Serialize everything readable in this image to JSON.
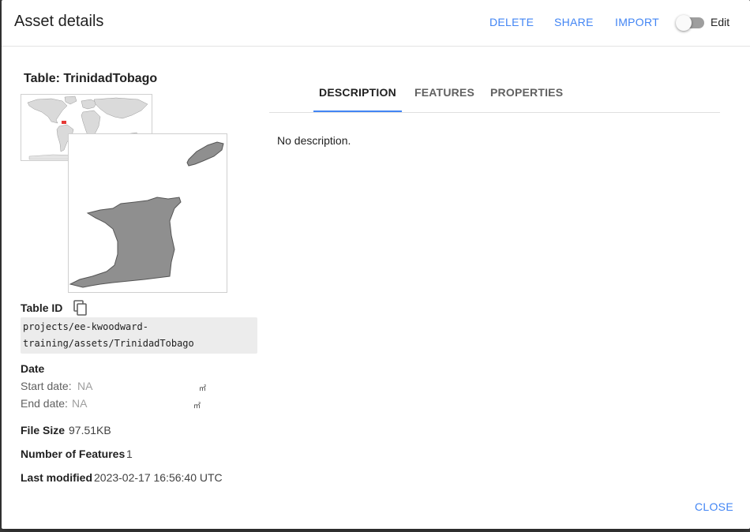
{
  "header": {
    "title": "Asset details",
    "delete_label": "DELETE",
    "share_label": "SHARE",
    "import_label": "IMPORT",
    "edit_label": "Edit",
    "edit_enabled": false
  },
  "asset": {
    "title": "Table: TrinidadTobago",
    "table_id_label": "Table ID",
    "table_id_line1": "projects/ee-kwoodward-",
    "table_id_line2": "training/assets/TrinidadTobago",
    "date_label": "Date",
    "start_date_label": "Start date:",
    "start_date_value": "NA",
    "end_date_label": "End date:",
    "end_date_value": "NA",
    "picker_glyph": "㎡",
    "file_size_label": "File Size",
    "file_size_value": "97.51KB",
    "num_features_label": "Number of Features",
    "num_features_value": "1",
    "last_modified_label": "Last modified",
    "last_modified_value": "2023-02-17 16:56:40 UTC"
  },
  "tabs": [
    {
      "label": "DESCRIPTION",
      "active": true
    },
    {
      "label": "FEATURES",
      "active": false
    },
    {
      "label": "PROPERTIES",
      "active": false
    }
  ],
  "description": "No description.",
  "footer": {
    "close_label": "CLOSE"
  },
  "colors": {
    "accent": "#4285f4",
    "map_land": "#8f8f8f",
    "world_land": "#dadada",
    "highlight": "#e53935"
  }
}
